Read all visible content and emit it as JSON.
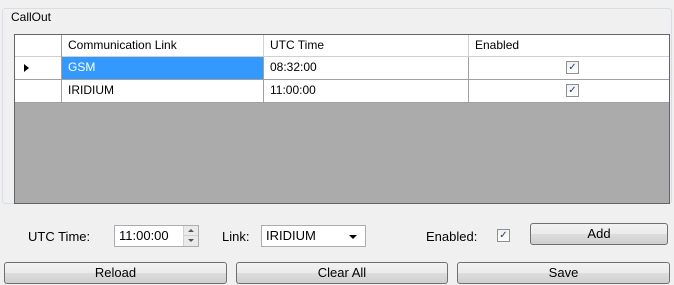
{
  "group": {
    "title": "CallOut"
  },
  "grid": {
    "columns": [
      "Communication Link",
      "UTC Time",
      "Enabled"
    ],
    "rows": [
      {
        "link": "GSM",
        "time": "08:32:00",
        "enabled": "✓",
        "selected": true
      },
      {
        "link": "IRIDIUM",
        "time": "11:00:00",
        "enabled": "✓",
        "selected": false
      }
    ]
  },
  "form": {
    "utc_label": "UTC Time:",
    "utc_value": "11:00:00",
    "link_label": "Link:",
    "link_value": "IRIDIUM",
    "enabled_label": "Enabled:",
    "enabled_check": "✓",
    "add_label": "Add"
  },
  "buttons": {
    "reload": "Reload",
    "clear_all": "Clear All",
    "save": "Save"
  },
  "colors": {
    "selection": "#3399ff",
    "grid_background": "#ababab"
  }
}
